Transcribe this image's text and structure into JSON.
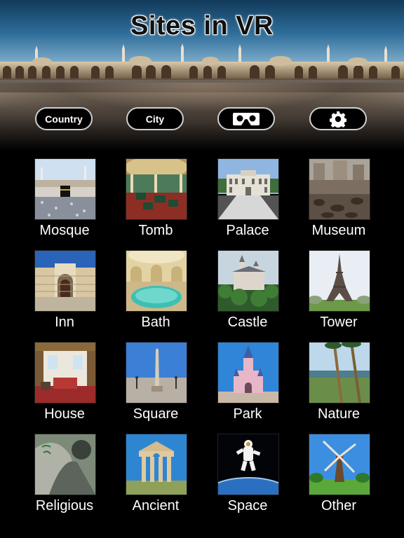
{
  "app": {
    "title": "Sites in VR"
  },
  "toolbar": {
    "country_label": "Country",
    "city_label": "City",
    "vr_icon": "vr-headset-icon",
    "settings_icon": "gear-icon"
  },
  "categories": [
    {
      "label": "Mosque"
    },
    {
      "label": "Tomb"
    },
    {
      "label": "Palace"
    },
    {
      "label": "Museum"
    },
    {
      "label": "Inn"
    },
    {
      "label": "Bath"
    },
    {
      "label": "Castle"
    },
    {
      "label": "Tower"
    },
    {
      "label": "House"
    },
    {
      "label": "Square"
    },
    {
      "label": "Park"
    },
    {
      "label": "Nature"
    },
    {
      "label": "Religious"
    },
    {
      "label": "Ancient"
    },
    {
      "label": "Space"
    },
    {
      "label": "Other"
    }
  ]
}
